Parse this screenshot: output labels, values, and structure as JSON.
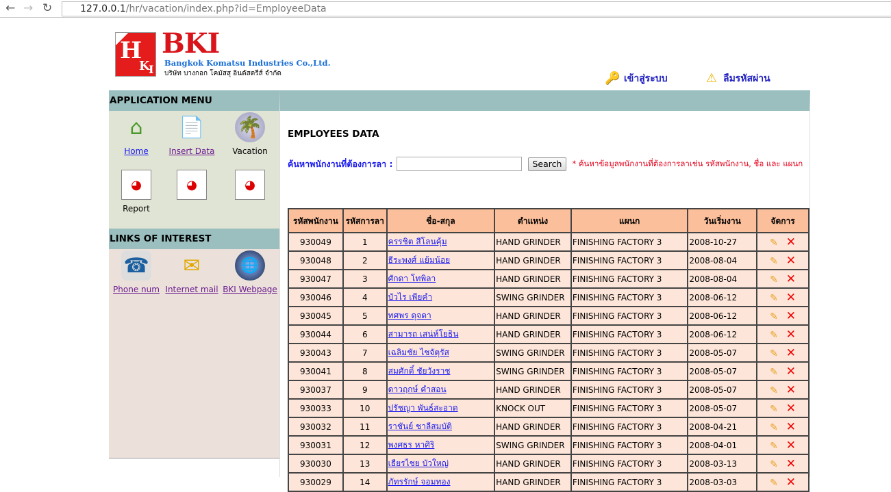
{
  "browser": {
    "url_host": "127.0.0.1",
    "url_path": "/hr/vacation/index.php?id=EmployeeData"
  },
  "header": {
    "logo_text": "BKI",
    "company_en": "Bangkok Komatsu Industries Co.,Ltd.",
    "company_th": "บริษัท บางกอก โคมัสสุ อินดัสตรีส์ จำกัด",
    "login": "เข้าสู่ระบบ",
    "forgot_password": "ลืมรหัสผ่าน"
  },
  "sidebar": {
    "app_menu_title": "APPLICATION MENU",
    "items": [
      {
        "label": "Home",
        "icon": "home-icon"
      },
      {
        "label": "Insert Data",
        "icon": "insert-document-icon"
      },
      {
        "label": "Vacation",
        "icon": "beach-icon"
      },
      {
        "label": "Report",
        "icon": "report-chart-icon"
      },
      {
        "label": "",
        "icon": "report-chart-icon"
      },
      {
        "label": "",
        "icon": "report-chart-icon"
      }
    ],
    "links_title": "LINKS OF INTEREST",
    "links": [
      {
        "label": "Phone num",
        "icon": "phone-icon"
      },
      {
        "label": "Internet mail",
        "icon": "mail-icon"
      },
      {
        "label": "BKI Webpage",
        "icon": "globe-icon"
      }
    ]
  },
  "main": {
    "title": "EMPLOYEES DATA",
    "search_label": "ค้นหาพนักงานที่ต้องการลา :",
    "search_value": "",
    "search_button": "Search",
    "search_hint": "* ค้นหาข้อมูลพนักงานที่ต้องการลาเช่น รหัสพนักงาน, ชื่อ และ แผนก",
    "columns": [
      "รหัสพนักงาน",
      "รหัสการลา",
      "ชื่อ-สกุล",
      "ตำแหน่ง",
      "แผนก",
      "วันเริ่มงาน",
      "จัดการ"
    ],
    "rows": [
      [
        "930049",
        "1",
        "ครรชิต สีโลนคุ้ม",
        "HAND GRINDER",
        "FINISHING FACTORY 3",
        "2008-10-27"
      ],
      [
        "930048",
        "2",
        "ธีระพงศ์ แย้มน้อย",
        "HAND GRINDER",
        "FINISHING FACTORY 3",
        "2008-08-04"
      ],
      [
        "930047",
        "3",
        "ศักดา โทพิลา",
        "HAND GRINDER",
        "FINISHING FACTORY 3",
        "2008-08-04"
      ],
      [
        "930046",
        "4",
        "บัวไร เพียคำ",
        "SWING GRINDER",
        "FINISHING FACTORY 3",
        "2008-06-12"
      ],
      [
        "930045",
        "5",
        "ทศพร ดุจดา",
        "HAND GRINDER",
        "FINISHING FACTORY 3",
        "2008-06-12"
      ],
      [
        "930044",
        "6",
        "สามารถ เสน่ห์โยธิน",
        "HAND GRINDER",
        "FINISHING FACTORY 3",
        "2008-06-12"
      ],
      [
        "930043",
        "7",
        "เฉลิมชัย ไชจัตุรัส",
        "SWING GRINDER",
        "FINISHING FACTORY 3",
        "2008-05-07"
      ],
      [
        "930041",
        "8",
        "สมศักดิ์ ชัยวังราช",
        "SWING GRINDER",
        "FINISHING FACTORY 3",
        "2008-05-07"
      ],
      [
        "930037",
        "9",
        "ดาวฤกษ์ คำสอน",
        "HAND GRINDER",
        "FINISHING FACTORY 3",
        "2008-05-07"
      ],
      [
        "930033",
        "10",
        "ปรัชญา พันธ์สะอาด",
        "KNOCK OUT",
        "FINISHING FACTORY 3",
        "2008-05-07"
      ],
      [
        "930032",
        "11",
        "ราชันย์ ชาลีสมบัติ",
        "HAND GRINDER",
        "FINISHING FACTORY 3",
        "2008-04-21"
      ],
      [
        "930031",
        "12",
        "พงศธร หาศิริ",
        "SWING GRINDER",
        "FINISHING FACTORY 3",
        "2008-04-01"
      ],
      [
        "930030",
        "13",
        "เธียรไชย บัวใหญ่",
        "HAND GRINDER",
        "FINISHING FACTORY 3",
        "2008-03-13"
      ],
      [
        "930029",
        "14",
        "ภัทรรักษ์ จอมทอง",
        "HAND GRINDER",
        "FINISHING FACTORY 3",
        "2008-03-03"
      ]
    ]
  }
}
